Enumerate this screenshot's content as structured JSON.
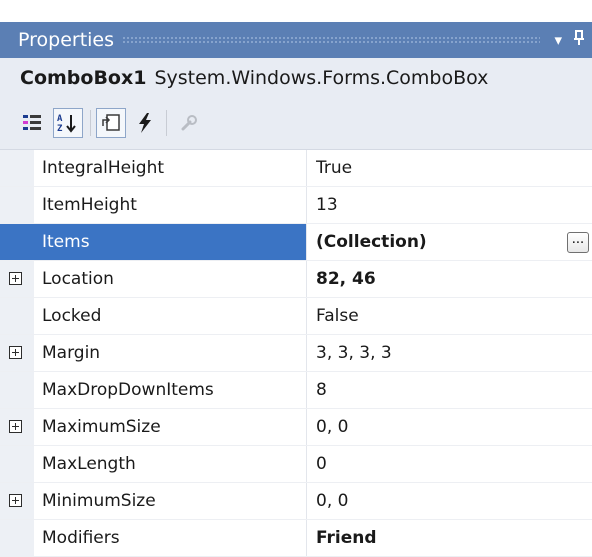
{
  "window": {
    "title": "Properties",
    "dropdown_glyph": "▾",
    "pin_glyph": "ᵽ"
  },
  "object_selector": {
    "name": "ComboBox1",
    "type": "System.Windows.Forms.ComboBox"
  },
  "toolbar": {
    "buttons": [
      {
        "icon": "categorized-icon",
        "pressed": false
      },
      {
        "icon": "alphabetical-icon",
        "pressed": true
      },
      {
        "icon": "properties-icon",
        "pressed": true
      },
      {
        "icon": "events-icon",
        "pressed": false
      },
      {
        "icon": "property-pages-icon",
        "pressed": false,
        "disabled": true
      }
    ]
  },
  "properties": [
    {
      "name": "IntegralHeight",
      "value": "True",
      "expandable": false,
      "bold": false,
      "selected": false
    },
    {
      "name": "ItemHeight",
      "value": "13",
      "expandable": false,
      "bold": false,
      "selected": false
    },
    {
      "name": "Items",
      "value": "(Collection)",
      "expandable": false,
      "bold": true,
      "selected": true,
      "button": "..."
    },
    {
      "name": "Location",
      "value": "82, 46",
      "expandable": true,
      "bold": true,
      "selected": false
    },
    {
      "name": "Locked",
      "value": "False",
      "expandable": false,
      "bold": false,
      "selected": false
    },
    {
      "name": "Margin",
      "value": "3, 3, 3, 3",
      "expandable": true,
      "bold": false,
      "selected": false
    },
    {
      "name": "MaxDropDownItems",
      "value": "8",
      "expandable": false,
      "bold": false,
      "selected": false
    },
    {
      "name": "MaximumSize",
      "value": "0, 0",
      "expandable": true,
      "bold": false,
      "selected": false
    },
    {
      "name": "MaxLength",
      "value": "0",
      "expandable": false,
      "bold": false,
      "selected": false
    },
    {
      "name": "MinimumSize",
      "value": "0, 0",
      "expandable": true,
      "bold": false,
      "selected": false
    },
    {
      "name": "Modifiers",
      "value": "Friend",
      "expandable": false,
      "bold": true,
      "selected": false
    }
  ],
  "colors": {
    "titlebar": "#5b7fb4",
    "selection": "#3b74c4",
    "toolbar_bg": "#e8ecf3"
  }
}
